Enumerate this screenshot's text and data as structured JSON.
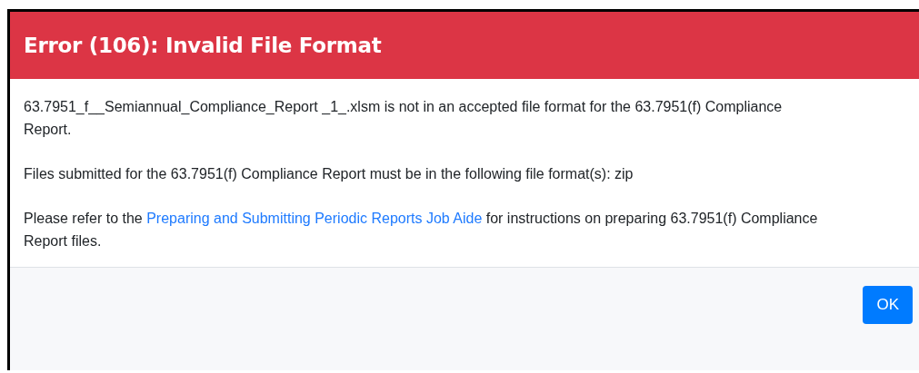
{
  "dialog": {
    "title": "Error (106): Invalid File Format",
    "paragraphs": [
      {
        "text": "63.7951_f__Semiannual_Compliance_Report _1_.xlsm is not in an accepted file format for the 63.7951(f) Compliance Report."
      },
      {
        "text": "Files submitted for the 63.7951(f) Compliance Report must be in the following file format(s): zip"
      },
      {
        "text": "Please refer to the ",
        "link": "Preparing and Submitting Periodic Reports Job Aide",
        "after": " for instructions on preparing 63.7951(f) Compliance Report files."
      }
    ],
    "buttons": [
      "OK"
    ]
  }
}
